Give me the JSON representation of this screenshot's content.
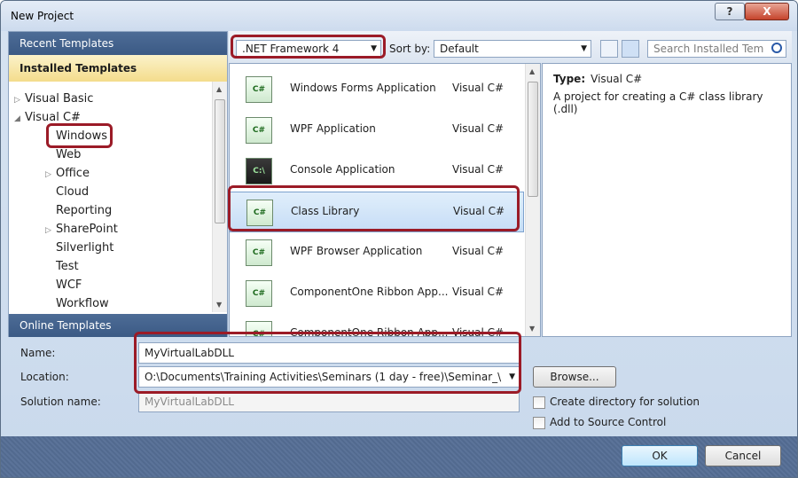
{
  "window": {
    "title": "New Project",
    "help_label": "?",
    "close_label": "X"
  },
  "left": {
    "recent_templates": "Recent Templates",
    "installed_templates": "Installed Templates",
    "online_templates": "Online Templates",
    "tree": [
      {
        "label": "Visual Basic"
      },
      {
        "label": "Visual C#"
      },
      {
        "label": "Windows"
      },
      {
        "label": "Web"
      },
      {
        "label": "Office"
      },
      {
        "label": "Cloud"
      },
      {
        "label": "Reporting"
      },
      {
        "label": "SharePoint"
      },
      {
        "label": "Silverlight"
      },
      {
        "label": "Test"
      },
      {
        "label": "WCF"
      },
      {
        "label": "Workflow"
      }
    ]
  },
  "toolbar": {
    "framework": ".NET Framework 4",
    "sort_label": "Sort by:",
    "sort_value": "Default",
    "search_placeholder": "Search Installed Tem"
  },
  "templates": [
    {
      "name": "Windows Forms Application",
      "lang": "Visual C#",
      "icon": "form-icon"
    },
    {
      "name": "WPF Application",
      "lang": "Visual C#",
      "icon": "wpf-icon"
    },
    {
      "name": "Console Application",
      "lang": "Visual C#",
      "icon": "console-icon"
    },
    {
      "name": "Class Library",
      "lang": "Visual C#",
      "icon": "class-library-icon"
    },
    {
      "name": "WPF Browser Application",
      "lang": "Visual C#",
      "icon": "wpf-browser-icon"
    },
    {
      "name": "ComponentOne Ribbon App...",
      "lang": "Visual C#",
      "icon": "ribbon-icon"
    },
    {
      "name": "ComponentOne Ribbon App...",
      "lang": "Visual C#",
      "icon": "ribbon-icon"
    }
  ],
  "description": {
    "type_label": "Type:",
    "type_value": "Visual C#",
    "text": "A project for creating a C# class library (.dll)"
  },
  "form": {
    "name_label": "Name:",
    "name_value": "MyVirtualLabDLL",
    "location_label": "Location:",
    "location_value": "O:\\Documents\\Training Activities\\Seminars (1 day - free)\\Seminar_\\",
    "solution_label": "Solution name:",
    "solution_value": "MyVirtualLabDLL",
    "browse_label": "Browse...",
    "create_dir_label": "Create directory for solution",
    "source_control_label": "Add to Source Control"
  },
  "footer": {
    "ok_label": "OK",
    "cancel_label": "Cancel"
  },
  "colors": {
    "highlight": "#9b1b27",
    "pane_header": "#4d6c96",
    "installed_bg": "#f4dc8c"
  }
}
